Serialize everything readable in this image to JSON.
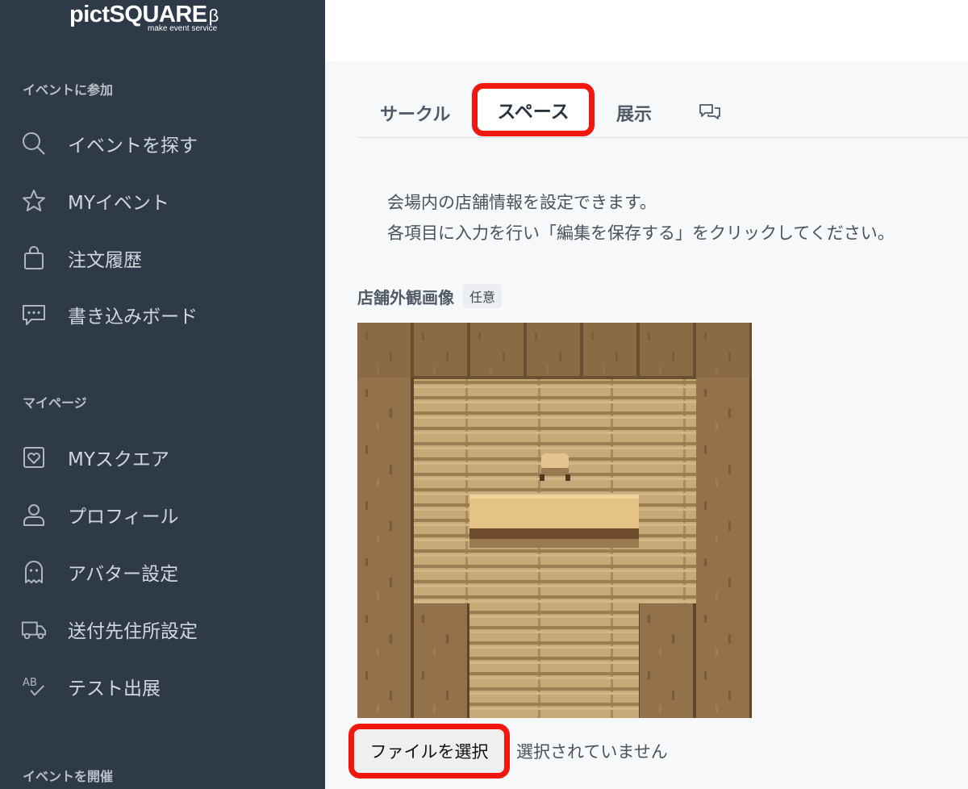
{
  "sidebar": {
    "logo": "pictSQUARE",
    "logo_beta": "β",
    "logo_sub": "make event service",
    "sections": [
      {
        "title": "イベントに参加"
      },
      {
        "title": "マイページ"
      },
      {
        "title": "イベントを開催"
      }
    ],
    "items": [
      {
        "label": "イベントを探す",
        "icon": "search-icon"
      },
      {
        "label": "MYイベント",
        "icon": "star-icon"
      },
      {
        "label": "注文履歴",
        "icon": "shopping-bag-icon"
      },
      {
        "label": "書き込みボード",
        "icon": "chat-bubble-icon"
      },
      {
        "label": "MYスクエア",
        "icon": "heart-frame-icon"
      },
      {
        "label": "プロフィール",
        "icon": "user-icon"
      },
      {
        "label": "アバター設定",
        "icon": "ghost-icon"
      },
      {
        "label": "送付先住所設定",
        "icon": "truck-icon"
      },
      {
        "label": "テスト出展",
        "icon": "ab-check-icon"
      }
    ]
  },
  "tabs": [
    {
      "label": "サークル",
      "active": false
    },
    {
      "label": "スペース",
      "active": true
    },
    {
      "label": "展示",
      "active": false
    },
    {
      "label": "",
      "icon": "comments-icon",
      "active": false
    }
  ],
  "description": [
    "会場内の店舗情報を設定できます。",
    "各項目に入力を行い「編集を保存する」をクリックしてください。"
  ],
  "field": {
    "label": "店舗外観画像",
    "badge": "任意"
  },
  "file_input": {
    "button_label": "ファイルを選択",
    "status": "選択されていません"
  },
  "colors": {
    "sidebar_bg": "#2f3a48",
    "highlight": "#f2180f",
    "wood_dark": "#8a6a44",
    "wood_light": "#c9a874"
  }
}
